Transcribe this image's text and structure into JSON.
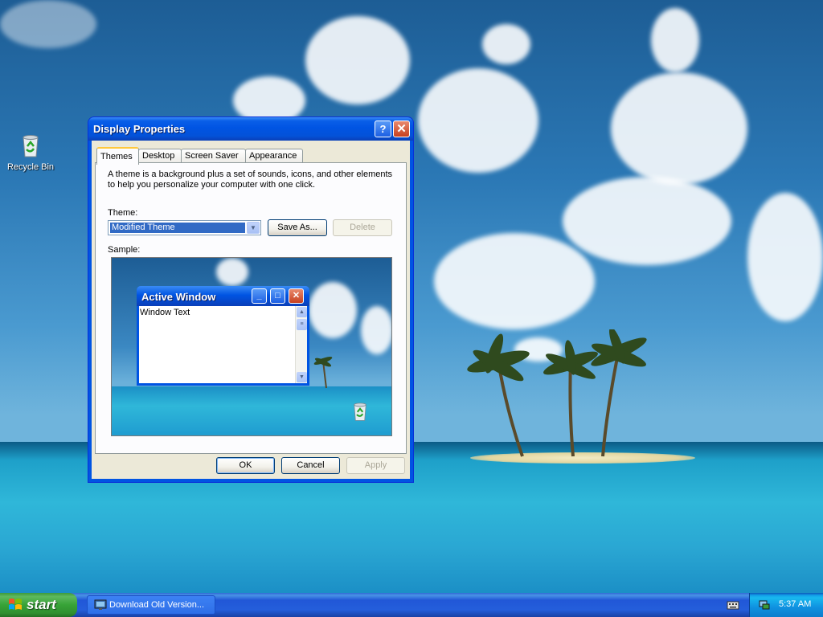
{
  "desktop": {
    "icons": [
      {
        "label": "Recycle Bin",
        "icon": "recycle-bin-icon"
      }
    ]
  },
  "dialog": {
    "title": "Display Properties",
    "title_buttons": {
      "help": "?",
      "close": "✕"
    },
    "tabs": [
      "Themes",
      "Desktop",
      "Screen Saver",
      "Appearance"
    ],
    "active_tab": "Themes",
    "description": "A theme is a background plus a set of sounds, icons, and other elements to help you personalize your computer with one click.",
    "theme_label": "Theme:",
    "theme_value": "Modified Theme",
    "save_as_label": "Save As...",
    "delete_label": "Delete",
    "sample_label": "Sample:",
    "sample": {
      "window_title": "Active Window",
      "window_text": "Window Text"
    },
    "ok_label": "OK",
    "cancel_label": "Cancel",
    "apply_label": "Apply"
  },
  "taskbar": {
    "start_label": "start",
    "task_items": [
      "Download Old Version..."
    ],
    "clock": "5:37 AM"
  },
  "colors": {
    "title_blue": "#0054e3",
    "dialog_face": "#ece9d8",
    "selection": "#316ac5",
    "start_green": "#37a337",
    "active_tab_accent": "#ffc83c"
  }
}
